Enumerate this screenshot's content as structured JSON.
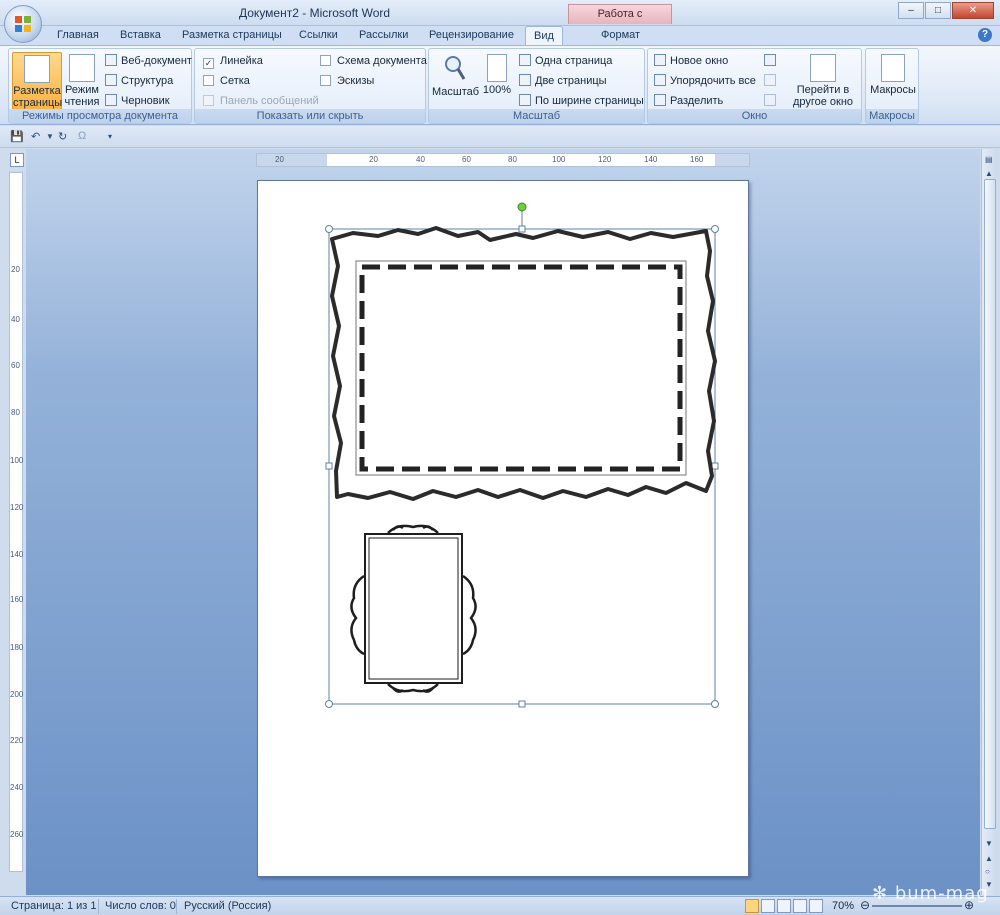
{
  "window": {
    "title": "Документ2 - Microsoft Word",
    "context_tab_group": "Работа с рисунками"
  },
  "tabs": [
    {
      "label": "Главная"
    },
    {
      "label": "Вставка"
    },
    {
      "label": "Разметка страницы"
    },
    {
      "label": "Ссылки"
    },
    {
      "label": "Рассылки"
    },
    {
      "label": "Рецензирование"
    },
    {
      "label": "Вид"
    },
    {
      "label": "Формат"
    }
  ],
  "ribbon": {
    "views": {
      "group_label": "Режимы просмотра документа",
      "page_layout": "Разметка страницы",
      "reading": "Режим чтения",
      "web": "Веб-документ",
      "outline": "Структура",
      "draft": "Черновик"
    },
    "show_hide": {
      "group_label": "Показать или скрыть",
      "ruler": "Линейка",
      "ruler_checked": true,
      "grid": "Сетка",
      "message_bar": "Панель сообщений",
      "doc_map": "Схема документа",
      "thumbnails": "Эскизы"
    },
    "zoom": {
      "group_label": "Масштаб",
      "zoom": "Масштаб",
      "hundred": "100%",
      "one_page": "Одна страница",
      "two_pages": "Две страницы",
      "page_width": "По ширине страницы"
    },
    "window": {
      "group_label": "Окно",
      "new_window": "Новое окно",
      "arrange_all": "Упорядочить все",
      "split": "Разделить",
      "switch": "Перейти в другое окно"
    },
    "macros": {
      "group_label": "Макросы",
      "macros": "Макросы"
    }
  },
  "ruler": {
    "horizontal": [
      "20",
      "20",
      "40",
      "60",
      "80",
      "100",
      "120",
      "140",
      "160"
    ],
    "vertical": [
      "20",
      "40",
      "60",
      "80",
      "100",
      "120",
      "140",
      "160",
      "180",
      "200",
      "220",
      "240",
      "260"
    ]
  },
  "statusbar": {
    "page": "Страница: 1 из 1",
    "words": "Число слов: 0",
    "language": "Русский (Россия)",
    "zoom": "70%"
  },
  "watermark": "bum-mag"
}
